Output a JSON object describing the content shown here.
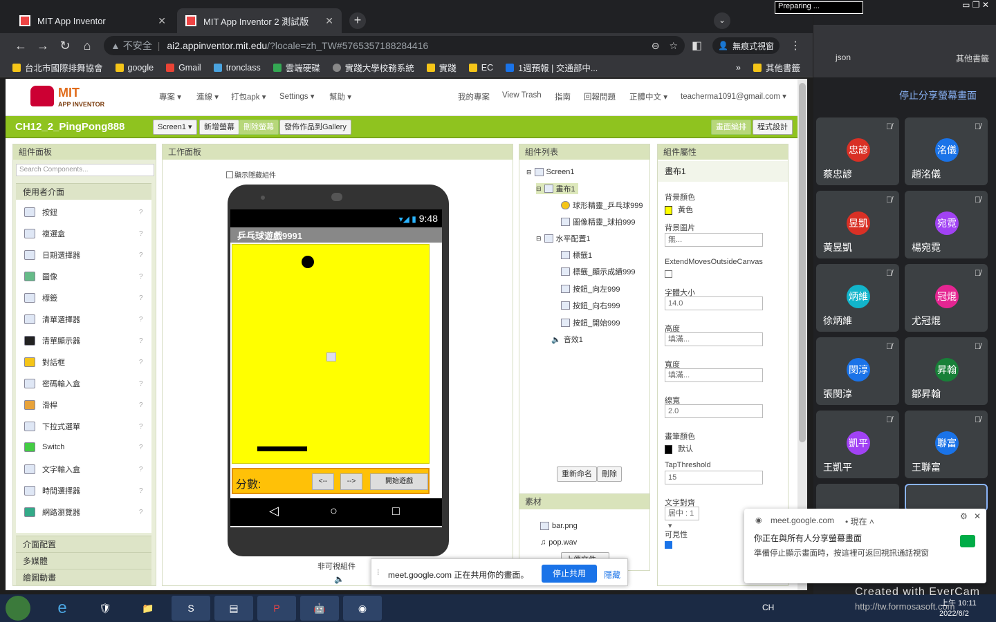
{
  "browser": {
    "tabs": [
      {
        "title": "MIT App Inventor",
        "close": "✕"
      },
      {
        "title": "MIT App Inventor 2 測試版",
        "close": "✕"
      }
    ],
    "new_tab": "+",
    "insecure_label": "不安全",
    "url_host": "ai2.appinventor.mit.edu",
    "url_rest": "/?locale=zh_TW#5765357188284416",
    "incognito_label": "無痕式視窗",
    "bookmarks": [
      "台北市國際排舞協會",
      "google",
      "Gmail",
      "tronclass",
      "雲端硬碟",
      "實踐大學校務系統",
      "實踐",
      "EC",
      "1週預報 | 交通部中...",
      "其他書籤"
    ],
    "bookmarks_more": "»"
  },
  "ai": {
    "logo_text": "MIT",
    "logo_sub": "APP INVENTOR",
    "menu": [
      "專案 ▾",
      "連線 ▾",
      "打包apk ▾",
      "Settings ▾",
      "幫助 ▾"
    ],
    "right_menu": [
      "我的專案",
      "View Trash",
      "指南",
      "回報問題",
      "正體中文 ▾",
      "teacherma1091@gmail.com ▾"
    ],
    "project_name": "CH12_2_PingPong888",
    "screen_select": "Screen1 ▾",
    "btn_add_screen": "新增螢幕",
    "btn_remove_screen": "刪除螢幕",
    "btn_publish": "發佈作品到Gallery",
    "btn_designer": "畫面編排",
    "btn_blocks": "程式設計"
  },
  "palette": {
    "title": "組件面板",
    "search_placeholder": "Search Components...",
    "category": "使用者介面",
    "items": [
      "按鈕",
      "複選盒",
      "日期選擇器",
      "圖像",
      "標籤",
      "清單選擇器",
      "清單顯示器",
      "對話框",
      "密碼輸入盒",
      "滑桿",
      "下拉式選單",
      "Switch",
      "文字輸入盒",
      "時間選擇器",
      "網路瀏覽器"
    ],
    "help": "?",
    "other_categories": [
      "介面配置",
      "多媒體",
      "繪圖動畫"
    ]
  },
  "viewer": {
    "title": "工作面板",
    "show_hidden": "顯示隱藏組件",
    "time": "9:48",
    "app_title": "乒乓球遊戲9991",
    "score_label": "分數:",
    "btn_left": "<--",
    "btn_right": "-->",
    "btn_start": "開始遊戲",
    "non_visible": "非可視組件"
  },
  "components": {
    "title": "組件列表",
    "tree": [
      "Screen1",
      "畫布1",
      "球形精靈_乒乓球999",
      "圖像精靈_球拍999",
      "水平配置1",
      "標籤1",
      "標籤_顯示成績999",
      "按鈕_向左999",
      "按鈕_向右999",
      "按鈕_開始999",
      "音效1"
    ],
    "rename": "重新命名",
    "delete": "刪除"
  },
  "media": {
    "title": "素材",
    "files": [
      "bar.png",
      "pop.wav"
    ],
    "upload": "上傳文件 ..."
  },
  "properties": {
    "title": "組件屬性",
    "component": "畫布1",
    "bg_color_label": "背景顏色",
    "bg_color_value": "黃色",
    "bg_color_hex": "#ffff00",
    "bg_image_label": "背景圖片",
    "bg_image_value": "無...",
    "extend_label": "ExtendMovesOutsideCanvas",
    "font_size_label": "字體大小",
    "font_size_value": "14.0",
    "height_label": "高度",
    "height_value": "填滿...",
    "width_label": "寬度",
    "width_value": "填滿...",
    "line_width_label": "線寬",
    "line_width_value": "2.0",
    "paint_color_label": "畫筆顏色",
    "paint_color_value": "默认",
    "tap_label": "TapThreshold",
    "tap_value": "15",
    "text_align_label": "文字對齊",
    "text_align_value": "居中 : 1 ▾",
    "visible_label": "可見性"
  },
  "sharebar": {
    "text": "meet.google.com 正在共用你的畫面。",
    "stop": "停止共用",
    "hide": "隱藏"
  },
  "meet": {
    "stop_share": "停止分享螢幕畫面",
    "participants": [
      {
        "avatar": "忠諺",
        "name": "蔡忠諺",
        "color": "#d93025"
      },
      {
        "avatar": "洺儀",
        "name": "趙洺儀",
        "color": "#1a73e8"
      },
      {
        "avatar": "昱凱",
        "name": "黃昱凱",
        "color": "#d93025"
      },
      {
        "avatar": "宛霓",
        "name": "楊宛霓",
        "color": "#a142f4"
      },
      {
        "avatar": "炳維",
        "name": "徐炳維",
        "color": "#12b5cb"
      },
      {
        "avatar": "冠焜",
        "name": "尤冠焜",
        "color": "#e52592"
      },
      {
        "avatar": "閔淳",
        "name": "張閔淳",
        "color": "#1a73e8"
      },
      {
        "avatar": "昇翰",
        "name": "鄒昇翰",
        "color": "#188038"
      },
      {
        "avatar": "凱平",
        "name": "王凱平",
        "color": "#a142f4"
      },
      {
        "avatar": "聯富",
        "name": "王聯富",
        "color": "#1a73e8"
      }
    ],
    "notif_source": "meet.google.com",
    "notif_time": "• 現在 ˄",
    "notif_title": "你正在與所有人分享螢幕畫面",
    "notif_body": "準備停止顯示畫面時，按這裡可返回視訊通話視窗",
    "recorder": "Preparing ..."
  },
  "taskbar": {
    "lang": "CH",
    "watermark1": "Created with EverCam",
    "watermark2": "http://tw.formosasoft.com",
    "time": "上午 10:11",
    "date": "2022/6/2"
  }
}
